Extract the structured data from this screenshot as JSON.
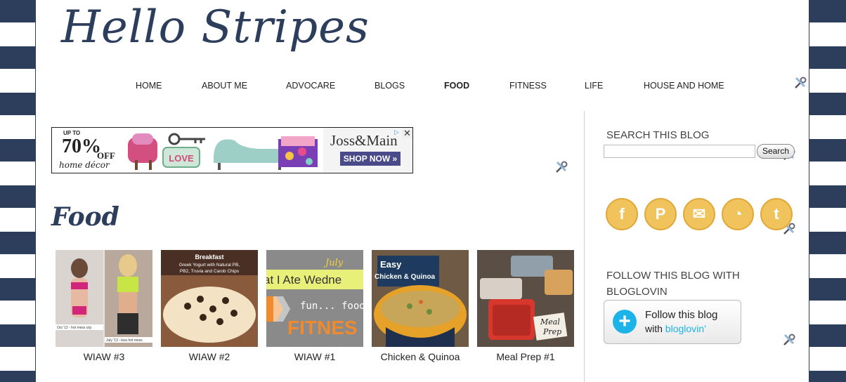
{
  "site": {
    "title": "Hello Stripes"
  },
  "nav": {
    "items": [
      {
        "label": "HOME"
      },
      {
        "label": "ABOUT ME"
      },
      {
        "label": "ADVOCARE"
      },
      {
        "label": "BLOGS"
      },
      {
        "label": "FOOD",
        "active": true
      },
      {
        "label": "FITNESS"
      },
      {
        "label": "LIFE"
      },
      {
        "label": "HOUSE AND HOME"
      }
    ]
  },
  "ad": {
    "up_to": "UP TO",
    "percent": "70%",
    "off": "OFF",
    "category": "home décor",
    "brand": "Joss&Main",
    "cta": "SHOP NOW »",
    "close": "✕",
    "info": "▷"
  },
  "main": {
    "heading": "Food",
    "posts": [
      {
        "label": "WIAW #3",
        "image_text": [
          "Oct '12 - hot mess city",
          "July '13 - less hot mess"
        ]
      },
      {
        "label": "WIAW #2",
        "image_text": [
          "Breakfast",
          "Greek Yogurt with Natural PB,",
          "PB2, Truvia and Carob Chips"
        ]
      },
      {
        "label": "WIAW #1",
        "image_text": [
          "July",
          "at I Ate Wedne",
          "fun... food",
          "FITNES"
        ]
      },
      {
        "label": "Chicken & Quinoa",
        "image_text": [
          "Easy",
          "Chicken & Quinoa"
        ]
      },
      {
        "label": "Meal Prep #1",
        "image_text": [
          "Meal",
          "Prep"
        ]
      }
    ]
  },
  "sidebar": {
    "search_heading": "SEARCH THIS BLOG",
    "search_button": "Search",
    "search_value": "",
    "social": [
      {
        "name": "facebook",
        "glyph": "f"
      },
      {
        "name": "pinterest",
        "glyph": "P"
      },
      {
        "name": "email",
        "glyph": "✉"
      },
      {
        "name": "rss",
        "glyph": "◔"
      },
      {
        "name": "twitter",
        "glyph": "t"
      }
    ],
    "follow_heading_1": "FOLLOW THIS BLOG WITH",
    "follow_heading_2": "BLOGLOVIN",
    "follow_line1": "Follow this blog",
    "follow_with": "with",
    "follow_brand": "bloglovin’",
    "follow_plus": "+"
  },
  "colors": {
    "navy": "#2c3e5c",
    "gold": "#f1c35c",
    "bloglovin_blue": "#1cb3e8"
  }
}
